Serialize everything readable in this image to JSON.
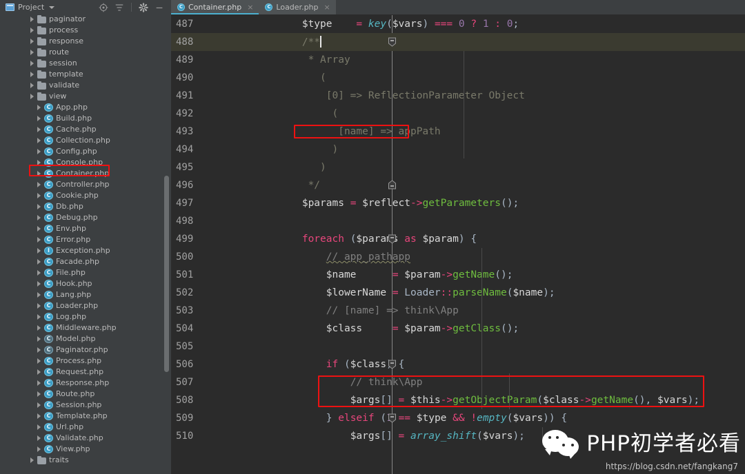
{
  "panel": {
    "title": "Project",
    "icons": [
      "collapse-target-icon",
      "collapse-all-icon",
      "settings-gear-icon",
      "minimize-icon"
    ]
  },
  "tree": {
    "items": [
      {
        "label": "paginator",
        "type": "folder"
      },
      {
        "label": "process",
        "type": "folder"
      },
      {
        "label": "response",
        "type": "folder"
      },
      {
        "label": "route",
        "type": "folder"
      },
      {
        "label": "session",
        "type": "folder"
      },
      {
        "label": "template",
        "type": "folder"
      },
      {
        "label": "validate",
        "type": "folder"
      },
      {
        "label": "view",
        "type": "folder"
      },
      {
        "label": "App.php",
        "type": "class"
      },
      {
        "label": "Build.php",
        "type": "class"
      },
      {
        "label": "Cache.php",
        "type": "class"
      },
      {
        "label": "Collection.php",
        "type": "class"
      },
      {
        "label": "Config.php",
        "type": "class"
      },
      {
        "label": "Console.php",
        "type": "class"
      },
      {
        "label": "Container.php",
        "type": "class",
        "highlighted": true
      },
      {
        "label": "Controller.php",
        "type": "class"
      },
      {
        "label": "Cookie.php",
        "type": "class"
      },
      {
        "label": "Db.php",
        "type": "class"
      },
      {
        "label": "Debug.php",
        "type": "class"
      },
      {
        "label": "Env.php",
        "type": "class"
      },
      {
        "label": "Error.php",
        "type": "class"
      },
      {
        "label": "Exception.php",
        "type": "interface"
      },
      {
        "label": "Facade.php",
        "type": "class"
      },
      {
        "label": "File.php",
        "type": "class"
      },
      {
        "label": "Hook.php",
        "type": "class"
      },
      {
        "label": "Lang.php",
        "type": "class"
      },
      {
        "label": "Loader.php",
        "type": "class"
      },
      {
        "label": "Log.php",
        "type": "class"
      },
      {
        "label": "Middleware.php",
        "type": "class"
      },
      {
        "label": "Model.php",
        "type": "abstract"
      },
      {
        "label": "Paginator.php",
        "type": "abstract"
      },
      {
        "label": "Process.php",
        "type": "class"
      },
      {
        "label": "Request.php",
        "type": "class"
      },
      {
        "label": "Response.php",
        "type": "class"
      },
      {
        "label": "Route.php",
        "type": "class"
      },
      {
        "label": "Session.php",
        "type": "class"
      },
      {
        "label": "Template.php",
        "type": "class"
      },
      {
        "label": "Url.php",
        "type": "class"
      },
      {
        "label": "Validate.php",
        "type": "class"
      },
      {
        "label": "View.php",
        "type": "class"
      },
      {
        "label": "traits",
        "type": "folder"
      }
    ]
  },
  "tabs": [
    {
      "label": "Container.php",
      "active": true,
      "close": "×"
    },
    {
      "label": "Loader.php",
      "active": false,
      "close": "×"
    }
  ],
  "code": {
    "first_line": 487,
    "current_line": 488,
    "lines": [
      {
        "n": "487",
        "text": "        $type    = key($vars) === 0 ? 1 : 0;"
      },
      {
        "n": "488",
        "text": "        /**"
      },
      {
        "n": "489",
        "text": "         * Array"
      },
      {
        "n": "490",
        "text": "           ("
      },
      {
        "n": "491",
        "text": "            [0] => ReflectionParameter Object"
      },
      {
        "n": "492",
        "text": "             ("
      },
      {
        "n": "493",
        "text": "              [name] => appPath"
      },
      {
        "n": "494",
        "text": "             )"
      },
      {
        "n": "495",
        "text": "           )"
      },
      {
        "n": "496",
        "text": "         */"
      },
      {
        "n": "497",
        "text": "        $params = $reflect->getParameters();"
      },
      {
        "n": "498",
        "text": ""
      },
      {
        "n": "499",
        "text": "        foreach ($params as $param) {"
      },
      {
        "n": "500",
        "text": "            // app_pathapp"
      },
      {
        "n": "501",
        "text": "            $name      = $param->getName();"
      },
      {
        "n": "502",
        "text": "            $lowerName = Loader::parseName($name);"
      },
      {
        "n": "503",
        "text": "            // [name] => think\\App"
      },
      {
        "n": "504",
        "text": "            $class     = $param->getClass();"
      },
      {
        "n": "505",
        "text": ""
      },
      {
        "n": "506",
        "text": "            if ($class) {"
      },
      {
        "n": "507",
        "text": "                // think\\App"
      },
      {
        "n": "508",
        "text": "                $args[] = $this->getObjectParam($class->getName(), $vars);"
      },
      {
        "n": "509",
        "text": "            } elseif (1 == $type && !empty($vars)) {"
      },
      {
        "n": "510",
        "text": "                $args[] = array_shift($vars);"
      }
    ]
  },
  "highlights": {
    "sidebar_item": "Container.php",
    "code_boxes": [
      "[name] => appPath",
      "// think\\App / $args[] = $this->getObjectParam($class->getName(), $vars);"
    ]
  },
  "watermark": {
    "text": "PHP初学者必看",
    "url": "https://blog.csdn.net/fangkang7",
    "icon": "wechat-logo-icon"
  },
  "colors": {
    "accent": "#4cb0d0",
    "highlight_box": "#ee1111",
    "editor_bg": "#2b2b2b",
    "sidebar_bg": "#3c3f41",
    "current_line_bg": "#3b3b30"
  }
}
